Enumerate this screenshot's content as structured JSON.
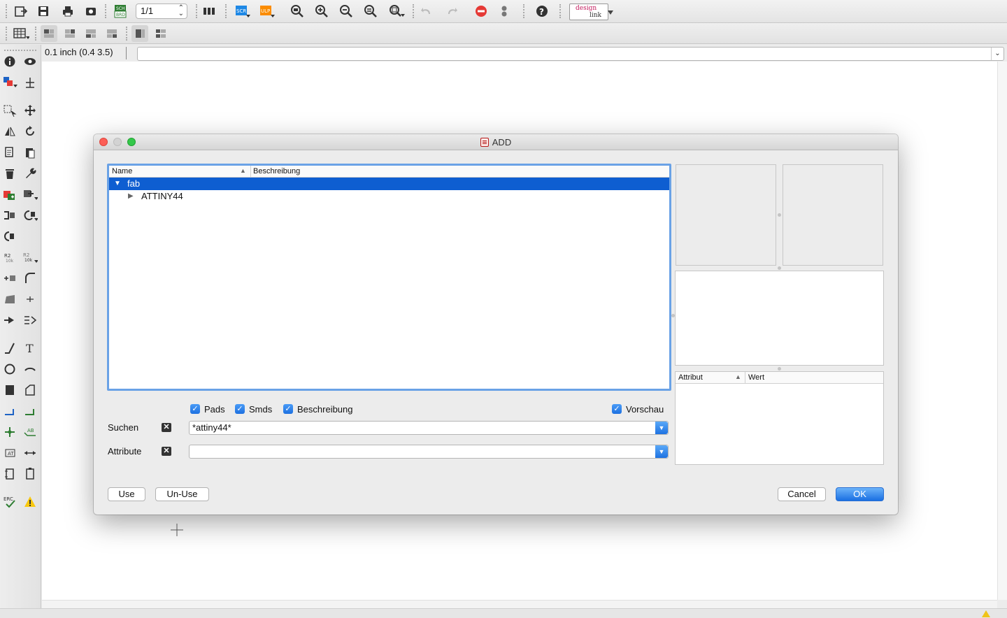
{
  "toolbar": {
    "page_value": "1/1",
    "logo_line1": "design",
    "logo_line2": "link",
    "icons": [
      "open-icon",
      "save-icon",
      "print-icon",
      "cam-icon",
      "sch-brd-switch-icon",
      "grid-icon",
      "script-icon",
      "ulp-icon",
      "zoom-fit-icon",
      "zoom-in-icon",
      "zoom-out-icon",
      "zoom-select-icon",
      "zoom-area-icon",
      "undo-icon",
      "redo-icon",
      "stop-icon",
      "go-icon",
      "help-icon"
    ]
  },
  "cmdbar": {
    "coordinate": "0.1 inch (0.4 3.5)",
    "command_value": ""
  },
  "dialog": {
    "title": "ADD",
    "tree": {
      "col_name": "Name",
      "col_desc": "Beschreibung",
      "rows": [
        {
          "name": "fab",
          "expanded": true,
          "selected": true
        },
        {
          "name": "ATTINY44",
          "expanded": false,
          "selected": false
        }
      ]
    },
    "attr_table": {
      "col_attr": "Attribut",
      "col_value": "Wert"
    },
    "checkboxes": {
      "pads": "Pads",
      "smds": "Smds",
      "description": "Beschreibung",
      "preview": "Vorschau"
    },
    "search": {
      "label": "Suchen",
      "value": "*attiny44*"
    },
    "attribute": {
      "label": "Attribute",
      "value": ""
    },
    "buttons": {
      "use": "Use",
      "unuse": "Un-Use",
      "cancel": "Cancel",
      "ok": "OK"
    }
  },
  "colors": {
    "selection": "#0e5ed1",
    "focus_ring": "#6aa2e6",
    "primary_button": "#1a6fe2"
  }
}
